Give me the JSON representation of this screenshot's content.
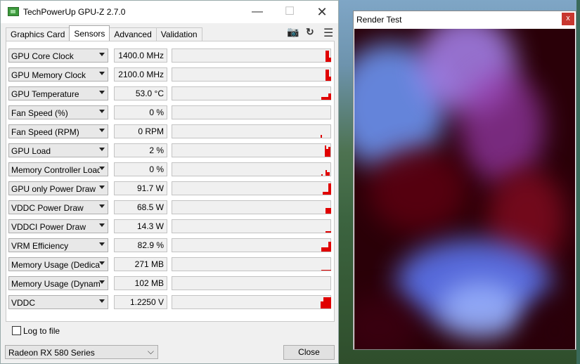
{
  "window": {
    "title": "TechPowerUp GPU-Z 2.7.0"
  },
  "tabs": [
    {
      "label": "Graphics Card"
    },
    {
      "label": "Sensors"
    },
    {
      "label": "Advanced"
    },
    {
      "label": "Validation"
    }
  ],
  "sensors": [
    {
      "label": "GPU Core Clock",
      "value": "1400.0 MHz"
    },
    {
      "label": "GPU Memory Clock",
      "value": "2100.0 MHz"
    },
    {
      "label": "GPU Temperature",
      "value": "53.0 °C"
    },
    {
      "label": "Fan Speed (%)",
      "value": "0 %"
    },
    {
      "label": "Fan Speed (RPM)",
      "value": "0 RPM"
    },
    {
      "label": "GPU Load",
      "value": "2 %"
    },
    {
      "label": "Memory Controller Load",
      "value": "0 %"
    },
    {
      "label": "GPU only Power Draw",
      "value": "91.7 W"
    },
    {
      "label": "VDDC Power Draw",
      "value": "68.5 W"
    },
    {
      "label": "VDDCI Power Draw",
      "value": "14.3 W"
    },
    {
      "label": "VRM Efficiency",
      "value": "82.9 %"
    },
    {
      "label": "Memory Usage (Dedicated)",
      "value": "271 MB"
    },
    {
      "label": "Memory Usage (Dynamic)",
      "value": "102 MB"
    },
    {
      "label": "VDDC",
      "value": "1.2250 V"
    }
  ],
  "log_to_file": {
    "label": "Log to file",
    "checked": false
  },
  "gpu_select": {
    "value": "Radeon RX 580 Series"
  },
  "close_button": {
    "label": "Close"
  },
  "render_window": {
    "title": "Render Test",
    "close_glyph": "x"
  },
  "colors": {
    "graph_bar": "#e00000",
    "close_red": "#c8372f"
  }
}
